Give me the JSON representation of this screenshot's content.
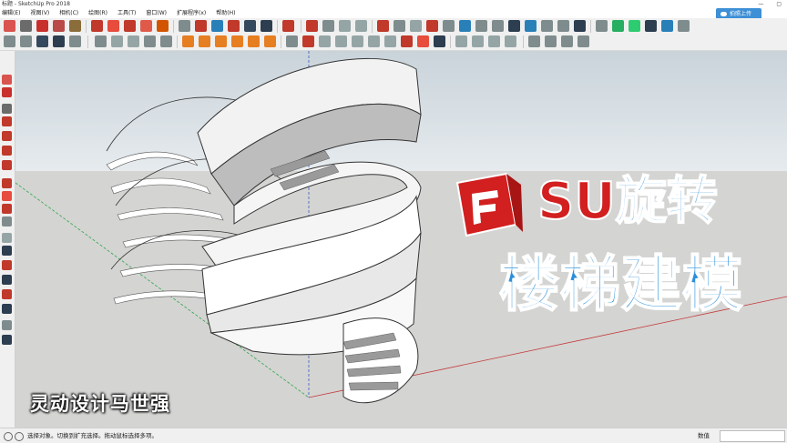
{
  "window": {
    "title": "标题 - SketchUp Pro 2018",
    "minimize": "—",
    "restore": "▢"
  },
  "menu": {
    "items": [
      "编辑(E)",
      "视图(V)",
      "相机(C)",
      "绘图(R)",
      "工具(T)",
      "窗口(W)",
      "扩展程序(x)",
      "帮助(H)"
    ]
  },
  "cloud_button": {
    "label": "拍照上传",
    "icon": "cloud-icon"
  },
  "overlay": {
    "title_latin": "SU",
    "title_cjk": "旋转",
    "subtitle": "楼梯建模",
    "watermark": "灵动设计马世强",
    "logo_icon": "sketchup-logo-icon"
  },
  "status": {
    "message": "选择对象。切换到扩充选择。拖动鼠标选择多项。",
    "value_label": "数值",
    "value": ""
  },
  "colors": {
    "accent": "#2b90d9",
    "brand_red": "#d21f1f",
    "sky": "#dfe6ea",
    "ground": "#d4d4d2",
    "axis_red": "#c43b3b",
    "axis_green": "#2aa84a",
    "axis_blue": "#3a5ec8"
  }
}
